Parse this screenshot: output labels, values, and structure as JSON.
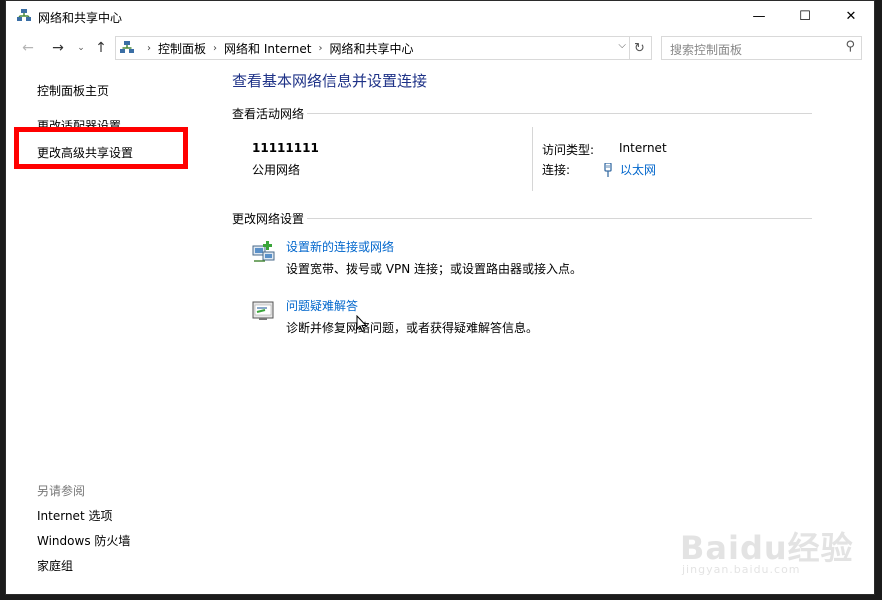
{
  "window": {
    "title": "网络和共享中心",
    "icon": "network-icon"
  },
  "titlebar_buttons": {
    "minimize": "—",
    "maximize": "☐",
    "close": "✕"
  },
  "navigation": {
    "back": "←",
    "forward": "→",
    "recent": "⌄",
    "up": "↑"
  },
  "breadcrumb": [
    "控制面板",
    "网络和 Internet",
    "网络和共享中心"
  ],
  "search": {
    "placeholder": "搜索控制面板"
  },
  "left_pane": {
    "items": [
      "控制面板主页",
      "更改适配器设置",
      "更改高级共享设置"
    ],
    "see_also_label": "另请参阅",
    "see_also": [
      "Internet 选项",
      "Windows 防火墙",
      "家庭组"
    ]
  },
  "main": {
    "title": "查看基本网络信息并设置连接",
    "active_networks_heading": "查看活动网络",
    "network": {
      "name": "11111111",
      "type": "公用网络",
      "access_type_label": "访问类型:",
      "access_type_value": "Internet",
      "connections_label": "连接:",
      "connections_value": "以太网"
    },
    "change_settings_heading": "更改网络设置",
    "tasks": [
      {
        "link": "设置新的连接或网络",
        "desc": "设置宽带、拨号或 VPN 连接；或设置路由器或接入点。",
        "icon": "new-connection-icon"
      },
      {
        "link": "问题疑难解答",
        "desc": "诊断并修复网络问题，或者获得疑难解答信息。",
        "icon": "troubleshoot-icon"
      }
    ]
  },
  "watermark": {
    "brand": "Baidu经验",
    "url": "jingyan.baidu.com"
  },
  "colors": {
    "link": "#0066cc",
    "title": "#1e3287",
    "highlight": "#ff0000"
  }
}
